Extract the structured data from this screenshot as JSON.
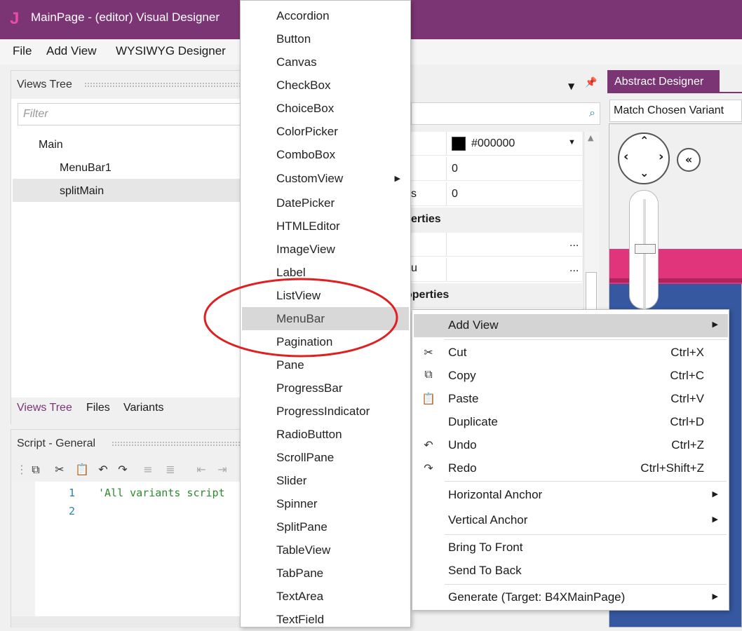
{
  "window": {
    "title": "MainPage - (editor) Visual Designer",
    "logo": "J"
  },
  "menubar": [
    "File",
    "Add View",
    "WYSIWYG Designer"
  ],
  "views_tree": {
    "title": "Views Tree",
    "filter_placeholder": "Filter",
    "items": [
      "Main",
      "MenuBar1",
      "splitMain"
    ],
    "tabs": [
      "Views Tree",
      "Files",
      "Variants"
    ]
  },
  "script": {
    "title": "Script - General",
    "line_numbers": [
      "1",
      "2"
    ],
    "code_line1": "'All variants script"
  },
  "properties": {
    "color_value": "#000000",
    "row2_value": "0",
    "row3_label_tail": "s",
    "row3_value": "0",
    "section1_tail": "erties",
    "row5_value": "...",
    "row6_label_tail": "u",
    "row6_value": "...",
    "section2_tail": "operties"
  },
  "abstract_designer": {
    "tab": "Abstract Designer",
    "variant_select": "Match Chosen Variant",
    "accent_colors": {
      "pink": "#e0357a",
      "blue": "#3558a0"
    }
  },
  "add_view_menu": [
    "Accordion",
    "Button",
    "Canvas",
    "CheckBox",
    "ChoiceBox",
    "ColorPicker",
    "ComboBox",
    "CustomView",
    "DatePicker",
    "HTMLEditor",
    "ImageView",
    "Label",
    "ListView",
    "MenuBar",
    "Pagination",
    "Pane",
    "ProgressBar",
    "ProgressIndicator",
    "RadioButton",
    "ScrollPane",
    "Slider",
    "Spinner",
    "SplitPane",
    "TableView",
    "TabPane",
    "TextArea",
    "TextField"
  ],
  "add_view_selected": "MenuBar",
  "context_menu": {
    "add_view": "Add View",
    "cut": "Cut",
    "cut_key": "Ctrl+X",
    "copy": "Copy",
    "copy_key": "Ctrl+C",
    "paste": "Paste",
    "paste_key": "Ctrl+V",
    "duplicate": "Duplicate",
    "duplicate_key": "Ctrl+D",
    "undo": "Undo",
    "undo_key": "Ctrl+Z",
    "redo": "Redo",
    "redo_key": "Ctrl+Shift+Z",
    "horizontal_anchor": "Horizontal Anchor",
    "vertical_anchor": "Vertical Anchor",
    "bring_to_front": "Bring To Front",
    "send_to_back": "Send To Back",
    "generate": "Generate (Target: B4XMainPage)"
  },
  "highlight_color": "#e02020"
}
